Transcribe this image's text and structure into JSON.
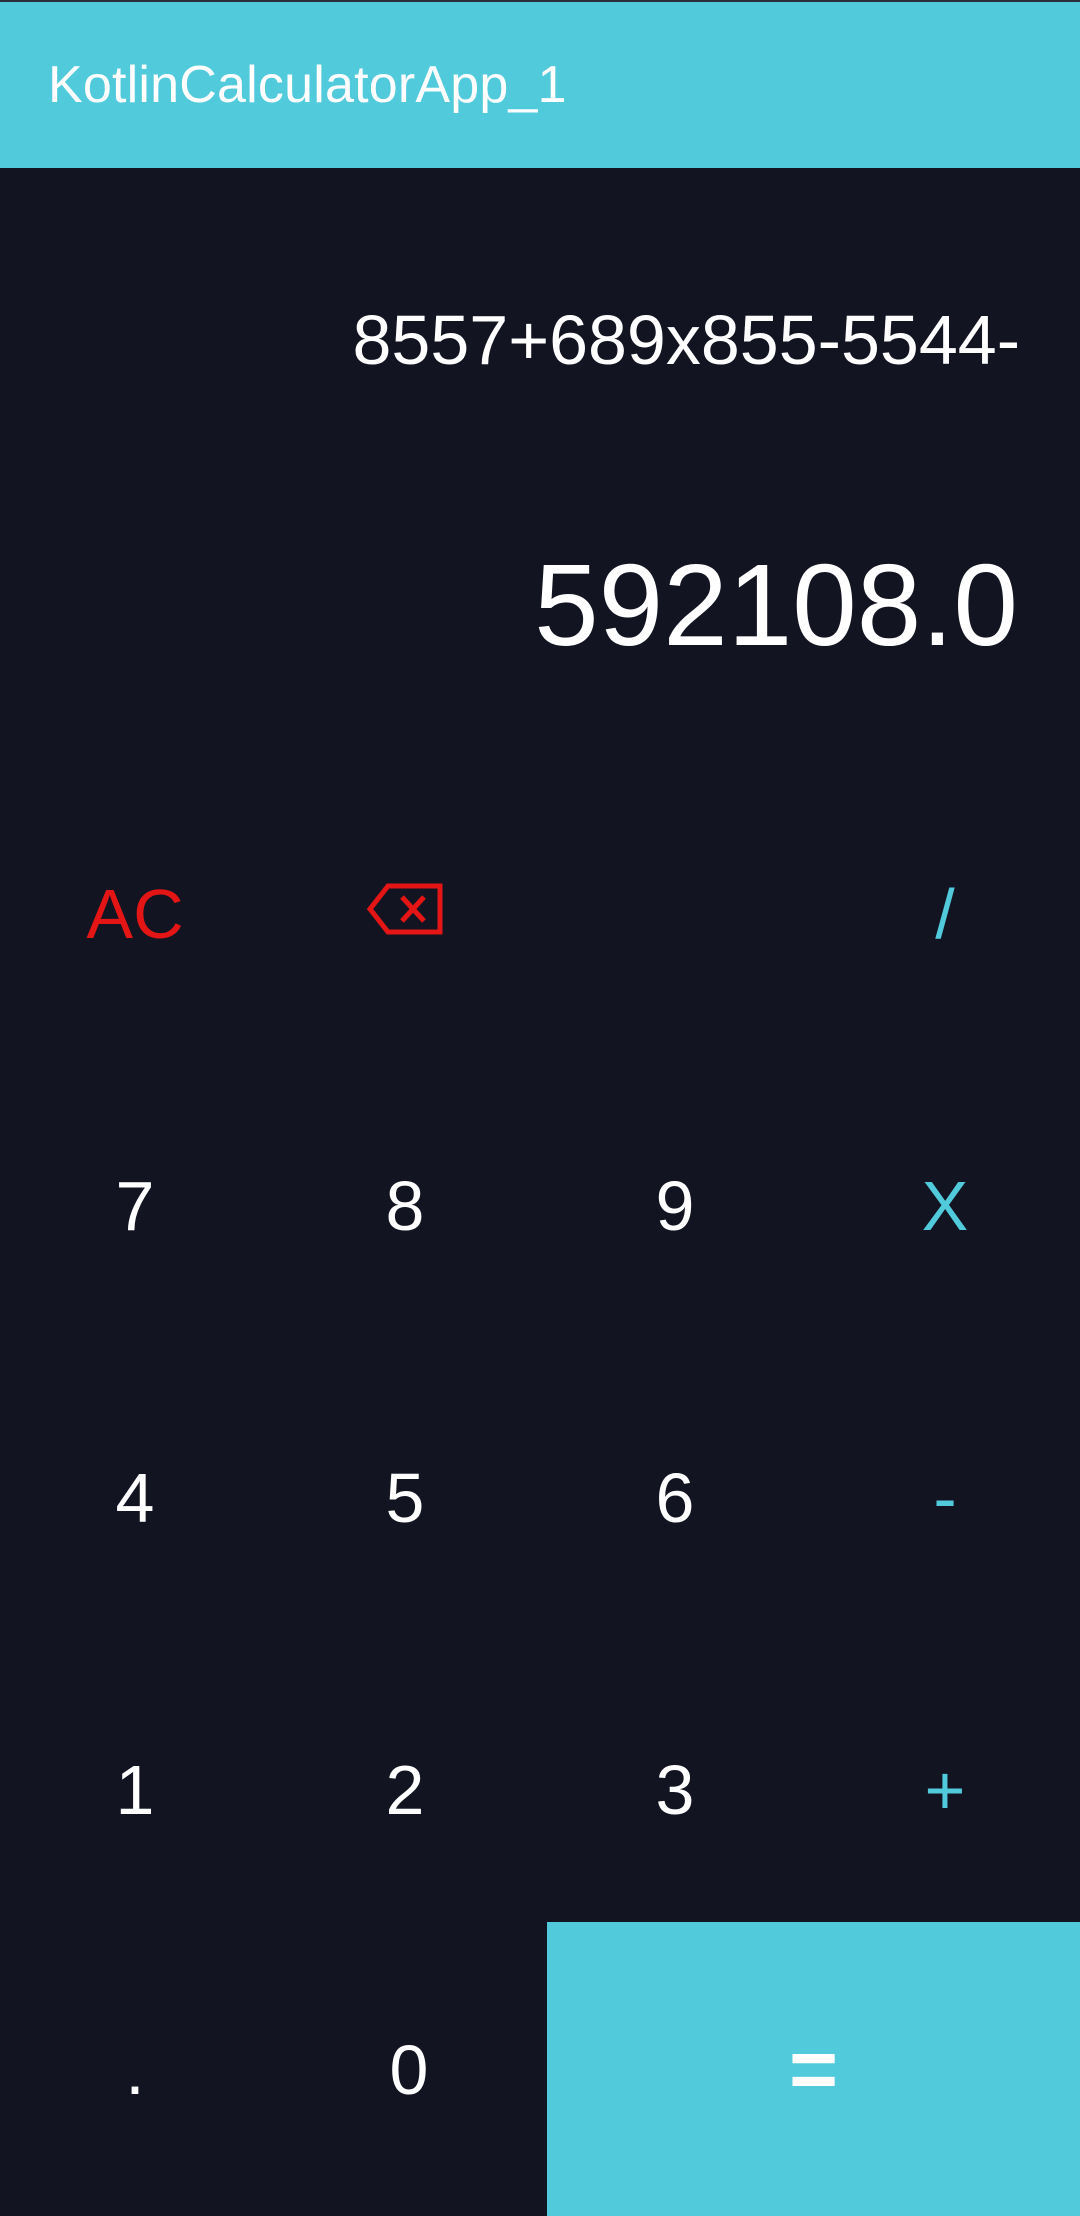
{
  "app_bar": {
    "title": "KotlinCalculatorApp_1",
    "background_color": "#51CADC"
  },
  "display": {
    "expression": "8557+689x855-5544-",
    "result": "592108.0"
  },
  "keypad": {
    "row1": {
      "clear_label": "AC",
      "backspace_icon": "backspace-icon",
      "divide_label": "/"
    },
    "row2": {
      "seven": "7",
      "eight": "8",
      "nine": "9",
      "multiply": "X"
    },
    "row3": {
      "four": "4",
      "five": "5",
      "six": "6",
      "minus": "-"
    },
    "row4": {
      "one": "1",
      "two": "2",
      "three": "3",
      "plus": "+"
    },
    "row5": {
      "decimal": ".",
      "zero": "0",
      "equals": "="
    }
  },
  "colors": {
    "background": "#121422",
    "accent": "#51CADC",
    "danger": "#E31515",
    "text": "#FFFFFF"
  }
}
